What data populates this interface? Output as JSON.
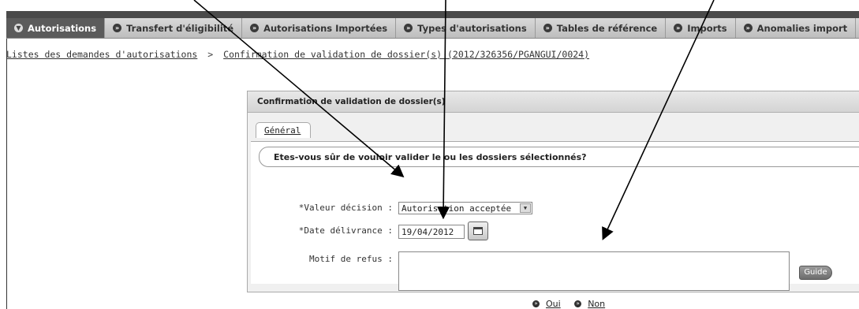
{
  "nav": {
    "items": [
      {
        "label": "Autorisations",
        "icon": "chevron-down-icon",
        "active": true
      },
      {
        "label": "Transfert d'éligibilité",
        "icon": "chevron-right-icon",
        "active": false
      },
      {
        "label": "Autorisations Importées",
        "icon": "chevron-right-icon",
        "active": false
      },
      {
        "label": "Types d'autorisations",
        "icon": "chevron-right-icon",
        "active": false
      },
      {
        "label": "Tables de référence",
        "icon": "chevron-right-icon",
        "active": false
      },
      {
        "label": "Imports",
        "icon": "chevron-right-icon",
        "active": false
      },
      {
        "label": "Anomalies import",
        "icon": "chevron-right-icon",
        "active": false
      }
    ]
  },
  "breadcrumb": {
    "root": "Listes des demandes d'autorisations",
    "separator": ">",
    "current": "Confirmation de validation de dossier(s) (2012/326356/PGANGUI/0024)"
  },
  "panel": {
    "title": "Confirmation de validation de dossier(s)",
    "tab_label": "Général",
    "question": "Etes-vous sûr de vouloir valider le ou les dossiers sélectionnés?"
  },
  "form": {
    "decision_label": "*Valeur décision :",
    "decision_value": "Autorisation acceptée",
    "date_label": "*Date délivrance :",
    "date_value": "19/04/2012",
    "motif_label": "Motif de refus :",
    "motif_value": "",
    "guide_label": "Guide"
  },
  "actions": {
    "yes_label": "Oui",
    "no_label": "Non"
  }
}
